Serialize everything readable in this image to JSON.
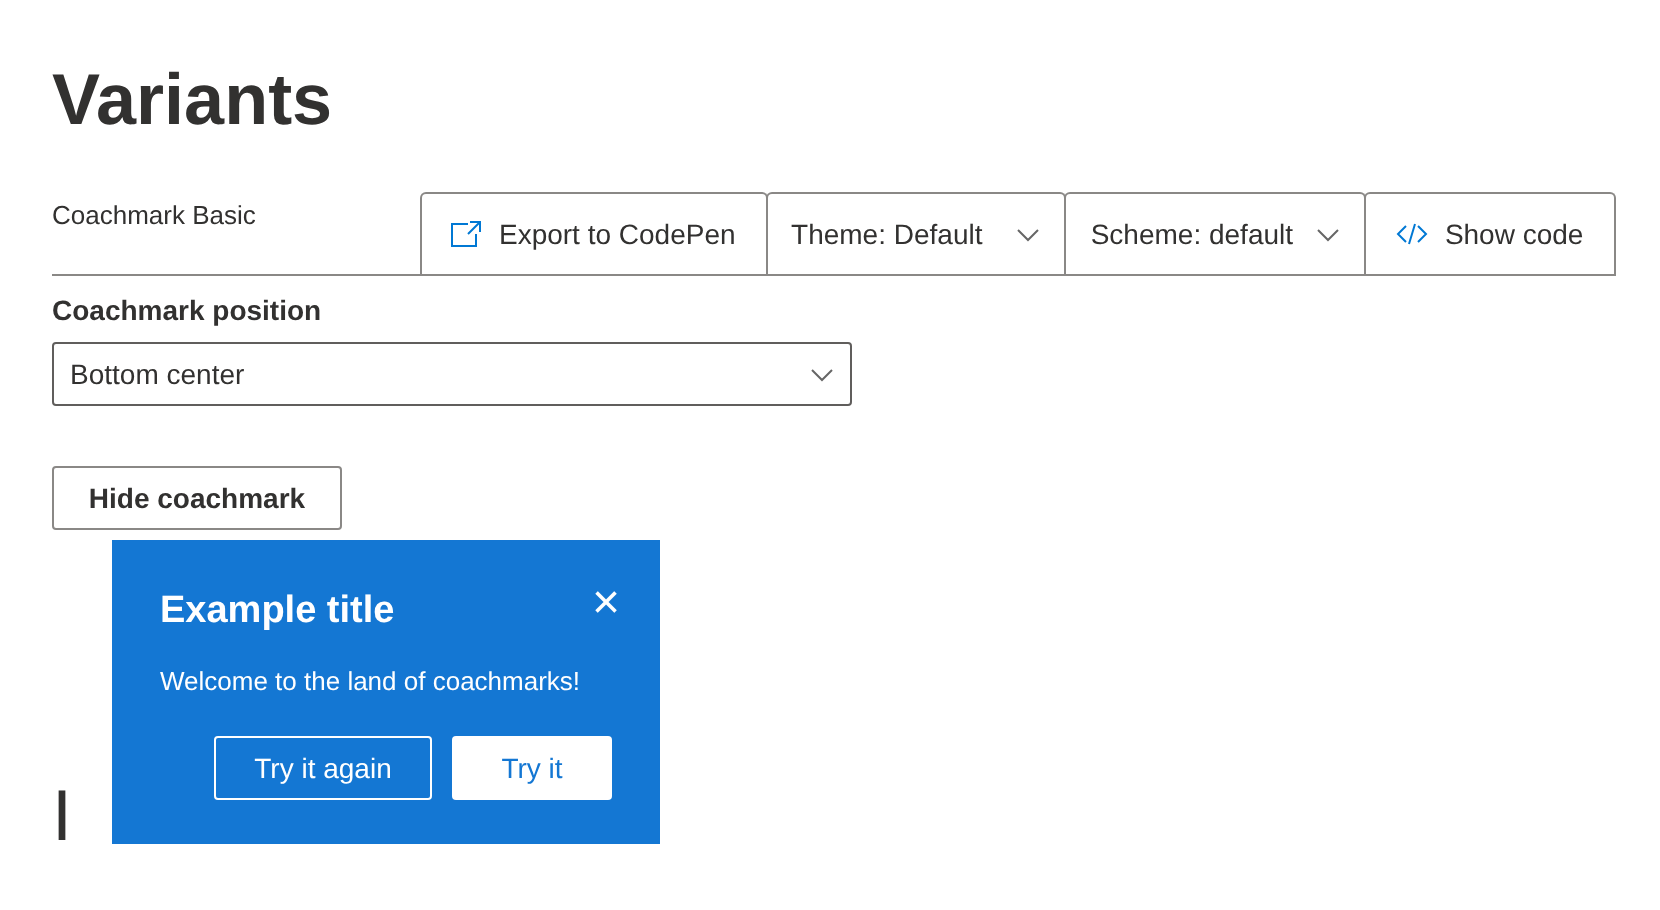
{
  "page_title": "Variants",
  "example": {
    "title": "Coachmark Basic",
    "toolbar": [
      {
        "kind": "export",
        "label": "Export to CodePen"
      },
      {
        "kind": "dropdown",
        "label": "Theme: Default"
      },
      {
        "kind": "dropdown",
        "label": "Scheme: default"
      },
      {
        "kind": "code",
        "label": "Show code"
      }
    ]
  },
  "position_field": {
    "label": "Coachmark position",
    "value": "Bottom center"
  },
  "hide_button": "Hide coachmark",
  "coachmark": {
    "title": "Example title",
    "close": "×",
    "body": "Welcome to the land of coachmarks!",
    "buttons": [
      {
        "label": "Try it again",
        "primary": false
      },
      {
        "label": "Try it",
        "primary": true
      }
    ]
  },
  "next_heading": "I"
}
